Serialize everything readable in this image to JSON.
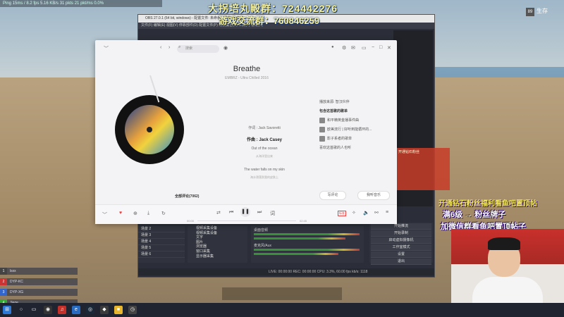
{
  "hud": {
    "stats": "Ping 15ms / 8.2 fps   5.16 KB/s   31 pkts   21 pkt/ms   0.0%"
  },
  "banners": {
    "qq_group": "大拐培丸殿群：724442276",
    "fan_group": "游戏交流群：760846259"
  },
  "obs": {
    "title": "OBS 27.0.1 (64 bit, windows) - 配置文件: 未命名 - 场景: 未命名",
    "menu": "文件(F)  编辑(E)  视图(V)  停靠部件(D)  配置文件(P)  场景集合(S)  工具(T)  帮助(H)",
    "scenes": [
      "场景 2",
      "场景 3",
      "场景 4",
      "场景 5",
      "场景 6"
    ],
    "sources": [
      "视频采集设备",
      "视频采集设备",
      "文字",
      "图片",
      "浏览器",
      "窗口采集",
      "显示器采集"
    ],
    "mixer": [
      "桌面音频",
      "麦克风/Aux"
    ],
    "controls": [
      "开始推流",
      "开始录制",
      "启动虚拟摄像机",
      "工作室模式",
      "设置",
      "退出"
    ],
    "status": "LIVE: 00:00:00   REC: 00:00:00   CPU: 3.3%, 60.00 fps   kb/s: 1118"
  },
  "music": {
    "search_placeholder": "搜索",
    "song_title": "Breathe",
    "song_meta": "EMBRZ - Ultra Chilled 2016",
    "lyrics": [
      {
        "text": "作词 : Jack Savoretti",
        "style": "normal"
      },
      {
        "text": "作曲 : Jack Casey",
        "style": "active"
      },
      {
        "text": "Out of the ocean",
        "style": "normal"
      },
      {
        "text": "从海洋里出来",
        "style": "sm"
      },
      {
        "text": "The water falls on my skin",
        "style": "normal"
      },
      {
        "text": "海水滑落到我的皮肤上",
        "style": "sm"
      }
    ],
    "side": {
      "source": "播放来源: 智汉伙伴",
      "header": "包含这首歌的歌单",
      "playlists": [
        "和平精英金播事件曲",
        "欧美流行 | 好听到能循环的...",
        "影子系者的歌单"
      ],
      "also_liked": "喜欢这首歌的人也听"
    },
    "comment_btn": "写评论",
    "share_btn": "我听音乐",
    "comments_count": "全部评论(7062)",
    "time_current": "00:00",
    "time_total": "02:45",
    "quality": "标准"
  },
  "stream": {
    "promo_line1": "开通钻石粉丝福利看鱼吧置顶帖",
    "promo_line2": "满6级 → 粉丝牌子",
    "promo_line3": "加微信群看鱼吧置顶帖子",
    "promo_small": "开通钻石粉丝",
    "save_badge": "生存"
  },
  "party": [
    {
      "num": "1",
      "name": "lsxx"
    },
    {
      "num": "2",
      "name": "DYP-KC"
    },
    {
      "num": "3",
      "name": "DYP-XG"
    },
    {
      "num": "4",
      "name": "Jiege"
    }
  ],
  "colors": {
    "accent": "#ec4141",
    "obs_bg": "#2b2e38",
    "taskbar": "#1f2430"
  }
}
